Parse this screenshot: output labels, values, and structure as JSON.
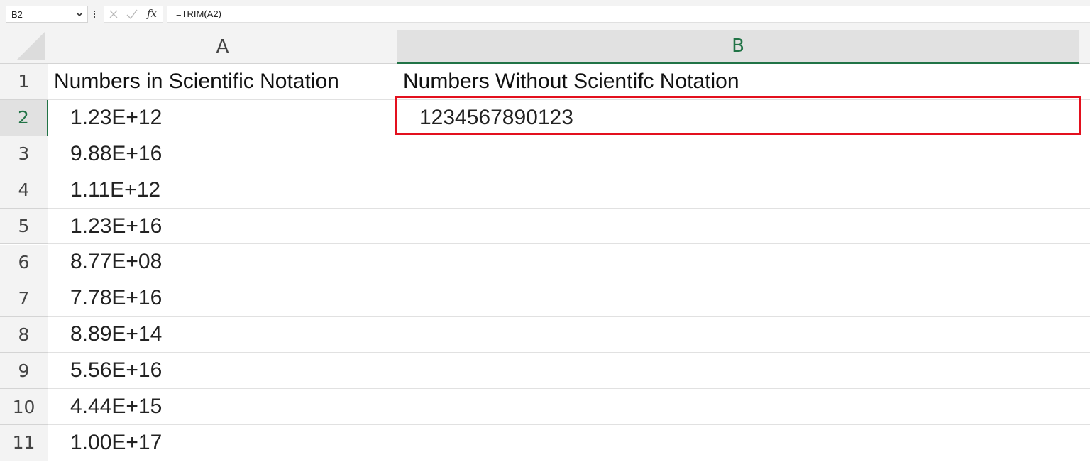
{
  "formula_bar": {
    "name_box": "B2",
    "fx_label": "fx",
    "formula": "=TRIM(A2)"
  },
  "columns": [
    {
      "label": "A",
      "selected": false
    },
    {
      "label": "B",
      "selected": true
    }
  ],
  "rows": [
    {
      "num": "1",
      "a": "Numbers in Scientific Notation",
      "b": "Numbers Without Scientifc Notation"
    },
    {
      "num": "2",
      "a": "1.23E+12",
      "b": "1234567890123"
    },
    {
      "num": "3",
      "a": "9.88E+16",
      "b": ""
    },
    {
      "num": "4",
      "a": "1.11E+12",
      "b": ""
    },
    {
      "num": "5",
      "a": "1.23E+16",
      "b": ""
    },
    {
      "num": "6",
      "a": "8.77E+08",
      "b": ""
    },
    {
      "num": "7",
      "a": "7.78E+16",
      "b": ""
    },
    {
      "num": "8",
      "a": "8.89E+14",
      "b": ""
    },
    {
      "num": "9",
      "a": "5.56E+16",
      "b": ""
    },
    {
      "num": "10",
      "a": "4.44E+15",
      "b": ""
    },
    {
      "num": "11",
      "a": "1.00E+17",
      "b": ""
    }
  ],
  "selected_cell": "B2",
  "colors": {
    "accent": "#217346",
    "highlight": "#e3101e"
  }
}
